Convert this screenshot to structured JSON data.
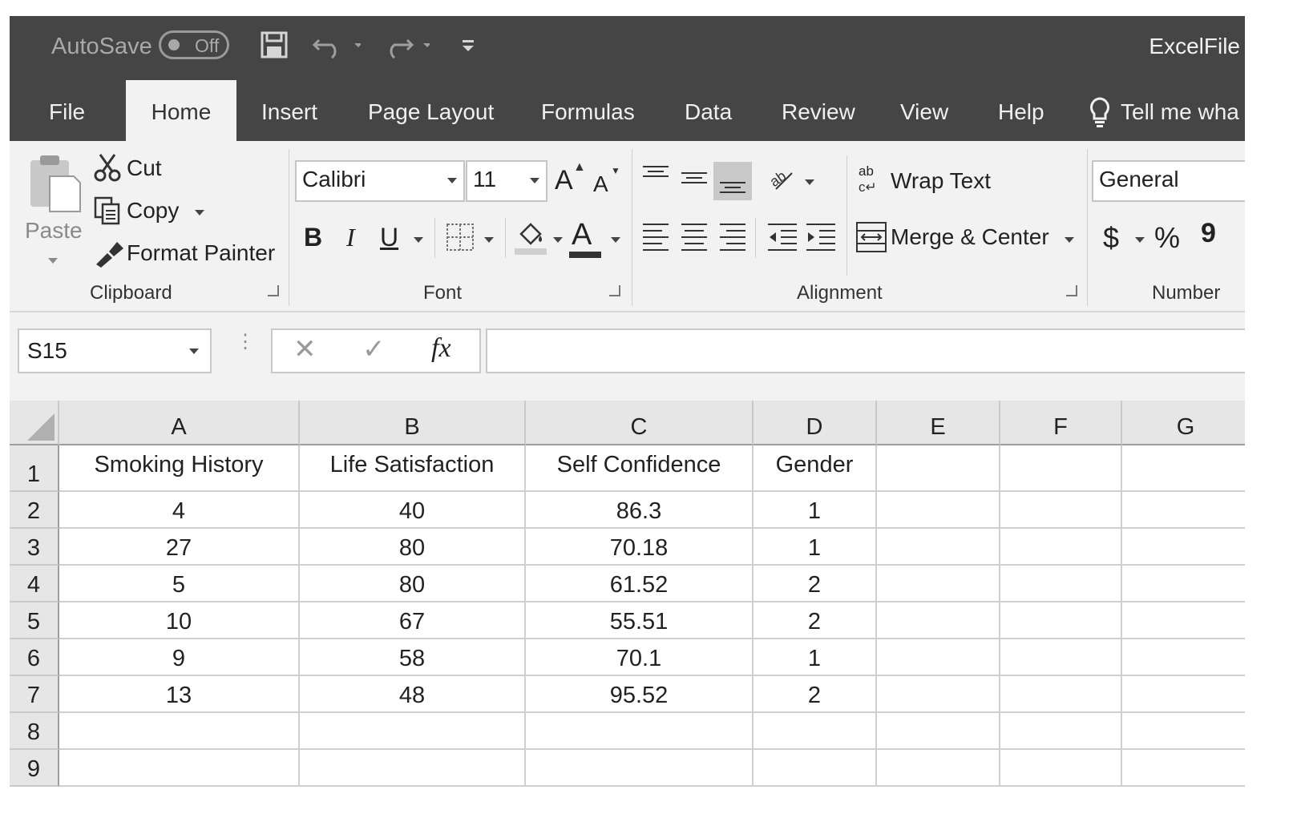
{
  "titlebar": {
    "autosave_label": "AutoSave",
    "autosave_state": "Off",
    "file_name": "ExcelFile"
  },
  "tabs": [
    "File",
    "Home",
    "Insert",
    "Page Layout",
    "Formulas",
    "Data",
    "Review",
    "View",
    "Help"
  ],
  "active_tab": "Home",
  "tell_me": "Tell me wha",
  "clipboard": {
    "paste_label": "Paste",
    "cut_label": "Cut",
    "copy_label": "Copy",
    "format_painter_label": "Format Painter",
    "group_label": "Clipboard"
  },
  "font": {
    "font_name": "Calibri",
    "font_size": "11",
    "bold": "B",
    "italic": "I",
    "underline": "U",
    "font_color_glyph": "A",
    "grow_glyph": "A",
    "shrink_glyph": "A",
    "group_label": "Font"
  },
  "alignment": {
    "wrap_text_label": "Wrap Text",
    "wrap_icon_text": "ab",
    "merge_center_label": "Merge & Center",
    "group_label": "Alignment"
  },
  "number": {
    "format_value": "General",
    "currency_symbol": "$",
    "percent_symbol": "%",
    "comma_symbol": "9",
    "group_label": "Number"
  },
  "formula_bar": {
    "name_box": "S15",
    "cancel_glyph": "✕",
    "enter_glyph": "✓",
    "fx_label": "fx",
    "formula_value": ""
  },
  "sheet": {
    "columns": [
      "A",
      "B",
      "C",
      "D",
      "E",
      "F",
      "G"
    ],
    "row_numbers": [
      "1",
      "2",
      "3",
      "4",
      "5",
      "6",
      "7",
      "8",
      "9"
    ],
    "rows": [
      [
        "Smoking History",
        "Life Satisfaction",
        "Self Confidence",
        "Gender",
        "",
        "",
        ""
      ],
      [
        "4",
        "40",
        "86.3",
        "1",
        "",
        "",
        ""
      ],
      [
        "27",
        "80",
        "70.18",
        "1",
        "",
        "",
        ""
      ],
      [
        "5",
        "80",
        "61.52",
        "2",
        "",
        "",
        ""
      ],
      [
        "10",
        "67",
        "55.51",
        "2",
        "",
        "",
        ""
      ],
      [
        "9",
        "58",
        "70.1",
        "1",
        "",
        "",
        ""
      ],
      [
        "13",
        "48",
        "95.52",
        "2",
        "",
        "",
        ""
      ],
      [
        "",
        "",
        "",
        "",
        "",
        "",
        ""
      ],
      [
        "",
        "",
        "",
        "",
        "",
        "",
        ""
      ]
    ]
  }
}
